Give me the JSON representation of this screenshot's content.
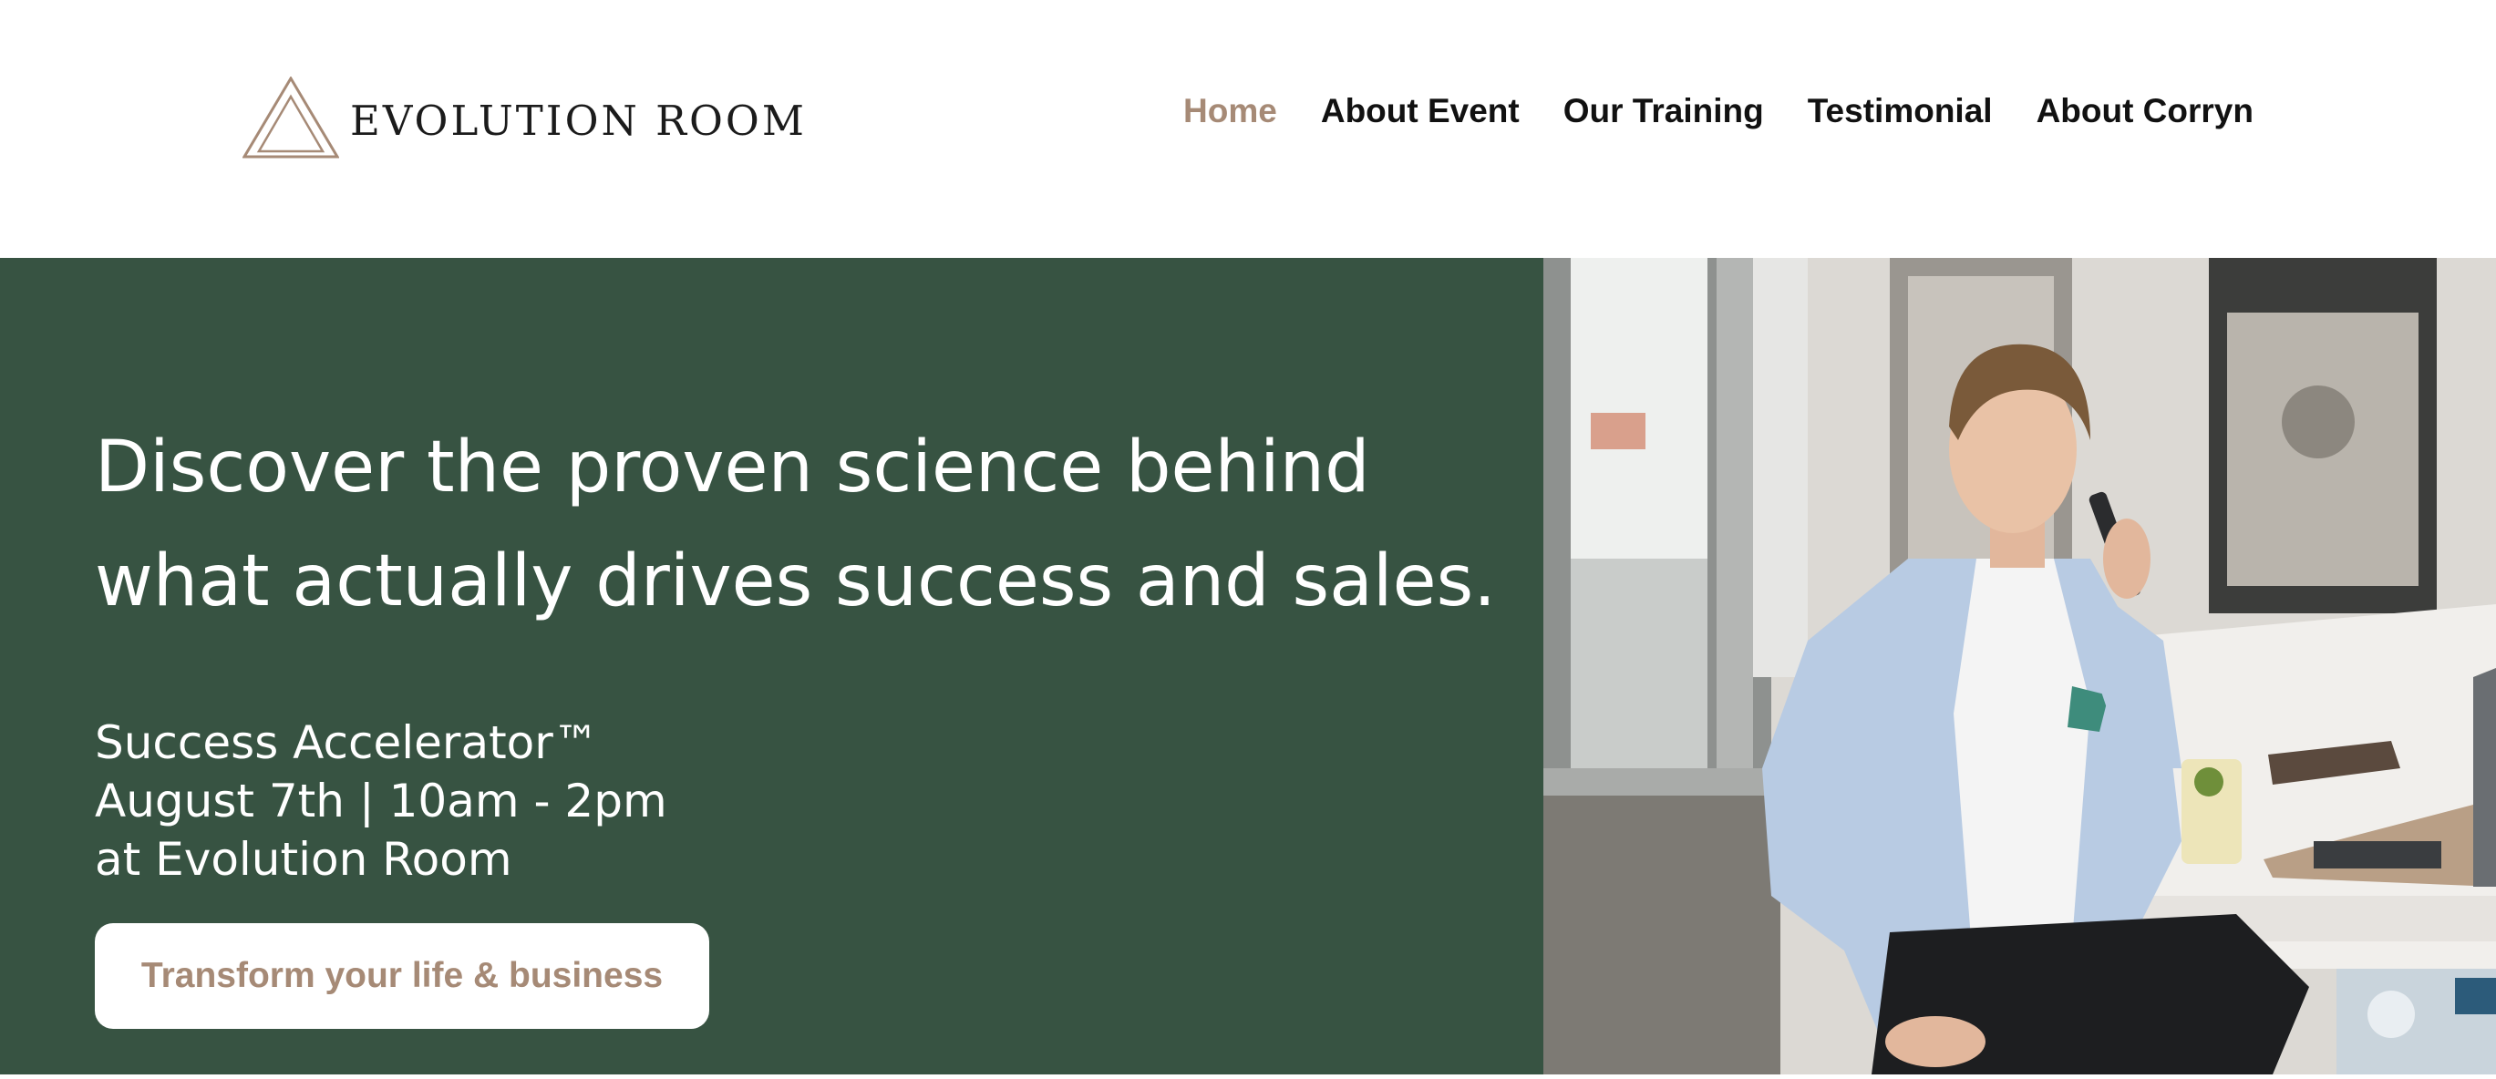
{
  "brand": {
    "name": "EVOLUTION ROOM",
    "logo_icon": "triangle-logo-icon",
    "accent_color": "#a68a76"
  },
  "nav": {
    "items": [
      {
        "label": "Home",
        "active": true
      },
      {
        "label": "About Event",
        "active": false
      },
      {
        "label": "Our Training",
        "active": false
      },
      {
        "label": "Testimonial",
        "active": false
      },
      {
        "label": "About Corryn",
        "active": false
      }
    ]
  },
  "hero": {
    "background_color": "#375342",
    "headline": "Discover the proven science behind what actually drives success and sales.",
    "event_name": "Success Accelerator™",
    "event_date": "August 7th | 10am - 2pm",
    "event_location": "at Evolution Room",
    "cta_label": "Transform your life & business",
    "photo": "man-on-phone-in-cafe-photo"
  }
}
